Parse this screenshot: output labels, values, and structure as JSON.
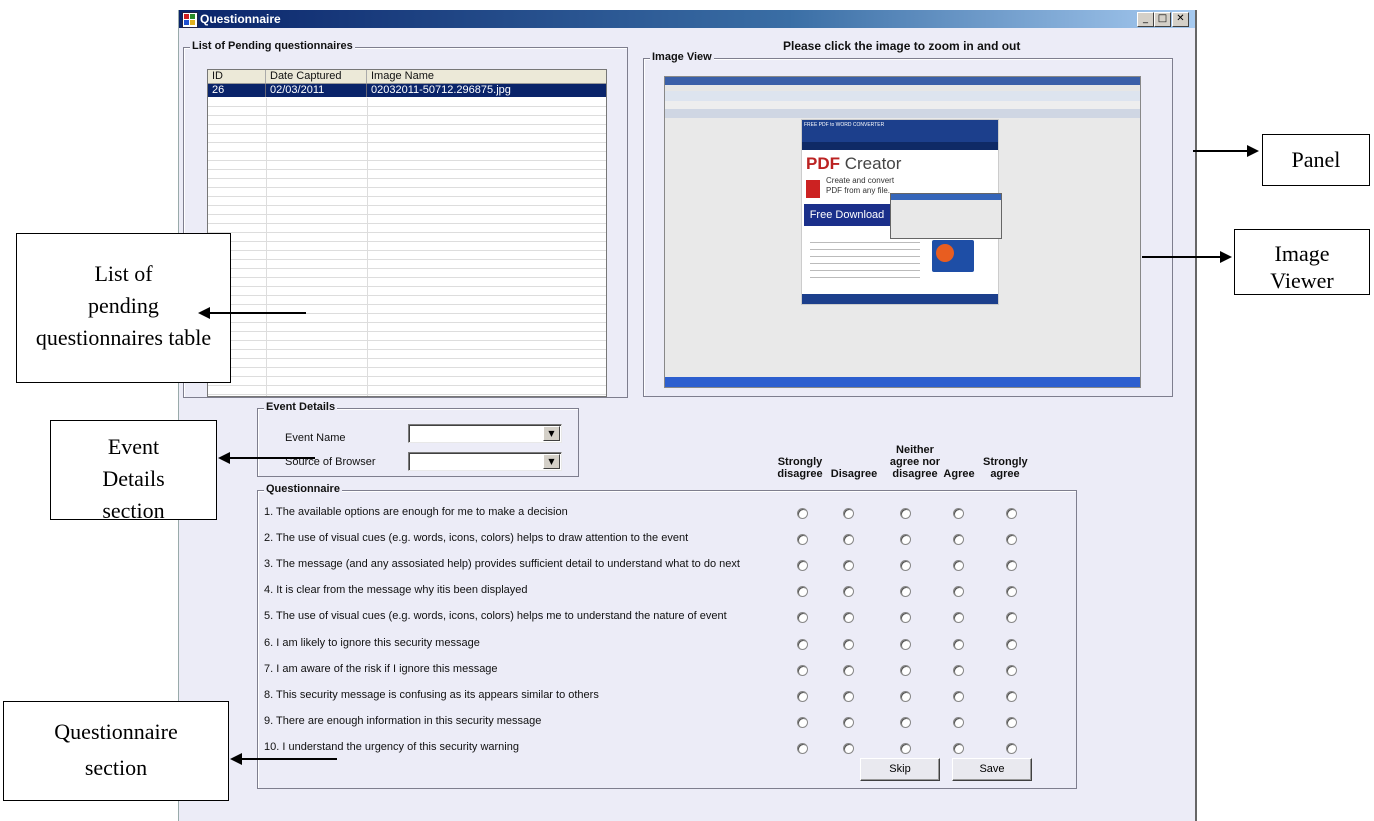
{
  "window": {
    "title": "Questionnaire",
    "controls": [
      "_",
      "□",
      "✕"
    ]
  },
  "pending": {
    "group_title": "List of Pending questionnaires",
    "columns": [
      "ID",
      "Date Captured",
      "Image Name"
    ],
    "rows": [
      {
        "id": "26",
        "date": "02/03/2011",
        "image": "02032011-50712.296875.jpg"
      }
    ]
  },
  "image_view": {
    "hint": "Please click the image to zoom in and out",
    "group_title": "Image View",
    "screenshot": {
      "header": "FREE PDF to WORD CONVERTER",
      "brand_main": "PDF",
      "brand_rest": " Creator",
      "tagline": "Create and convert PDF from any file.",
      "download_button": "Free Download"
    }
  },
  "event": {
    "group_title": "Event Details",
    "event_name_label": "Event Name",
    "browser_label": "Source of Browser",
    "event_name_value": "",
    "browser_value": ""
  },
  "scale": {
    "strongly_disagree": [
      "Strongly",
      "disagree"
    ],
    "disagree": "Disagree",
    "neutral": [
      "Neither",
      "agree nor",
      "disagree"
    ],
    "agree": "Agree",
    "strongly_agree": [
      "Strongly",
      "agree"
    ]
  },
  "questionnaire": {
    "group_title": "Questionnaire",
    "questions": [
      "1. The available options are enough for me to make a decision",
      "2. The use of visual cues (e.g. words, icons, colors) helps to draw attention to the event",
      "3. The message (and any assosiated help) provides sufficient detail to understand what to do next",
      "4. It is clear from the message why itis been displayed",
      "5. The use of visual cues (e.g. words, icons, colors) helps me to understand the nature of event",
      "6. I am likely to ignore this security message",
      "7. I am aware of the risk if I ignore this message",
      "8. This security message is confusing as its appears similar to others",
      "9. There are enough information in this security message",
      "10. I understand the urgency of this security warning"
    ],
    "skip_label": "Skip",
    "save_label": "Save"
  },
  "annotations": {
    "panel": "Panel",
    "image_viewer": "Image\nViewer",
    "pending_list": "List of\npending\nquestionnaires table",
    "event_section": "Event\nDetails\nsection",
    "questionnaire_section": "Questionnaire\nsection"
  }
}
